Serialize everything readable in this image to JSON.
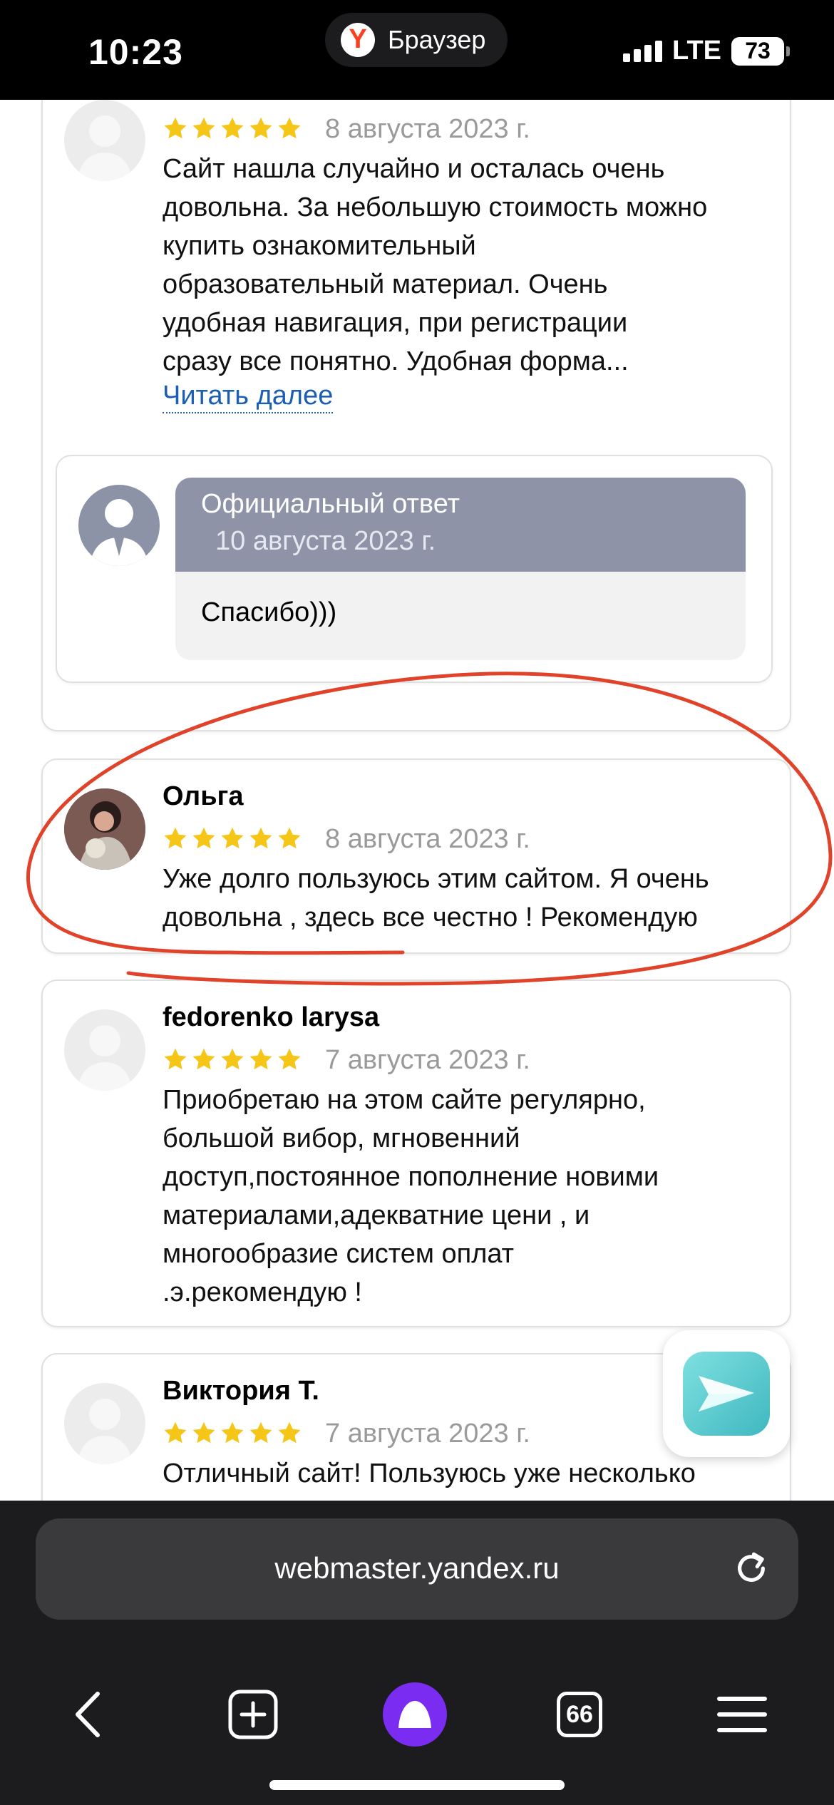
{
  "status_bar": {
    "time": "10:23",
    "app_name": "Браузер",
    "network": "LTE",
    "battery": "73"
  },
  "reviews": [
    {
      "name": "(partially hidden)",
      "rating": 5,
      "date": "8 августа 2023 г.",
      "text_lines": [
        "Сайт нашла случайно и осталась очень",
        "довольна. За небольшую стоимость можно",
        "купить ознакомительный",
        "образовательный материал. Очень",
        "удобная навигация, при регистрации",
        "сразу все понятно. Удобная форма..."
      ],
      "read_more": "Читать далее",
      "reply": {
        "title": "Официальный ответ",
        "date": "10 августа 2023 г.",
        "text": "Спасибо)))"
      }
    },
    {
      "name": "Ольга",
      "rating": 5,
      "date": "8 августа 2023 г.",
      "text_lines": [
        "Уже долго пользуюсь этим сайтом. Я очень",
        "довольна , здесь все честно ! Рекомендую"
      ]
    },
    {
      "name": "fedorenko larysa",
      "rating": 5,
      "date": "7 августа 2023 г.",
      "text_lines": [
        "Приобретаю на этом сайте регулярно,",
        "большой вибор, мгновенний",
        "доступ,постоянное пополнение новими",
        "материалами,адекватние цени , и",
        "многообразие систем оплат",
        ".э.рекомендую !"
      ]
    },
    {
      "name": "Виктория Т.",
      "rating": 5,
      "date": "7 августа 2023 г.",
      "text_lines": [
        "Отличный сайт! Пользуюсь уже несколько"
      ]
    }
  ],
  "browser": {
    "url": "webmaster.yandex.ru",
    "tab_count": "66"
  },
  "colors": {
    "star": "#f5c518",
    "link": "#1a5fb4",
    "annotation": "#e0432a",
    "reply_header": "#8f93a8",
    "alice": "#7a2cf0"
  }
}
